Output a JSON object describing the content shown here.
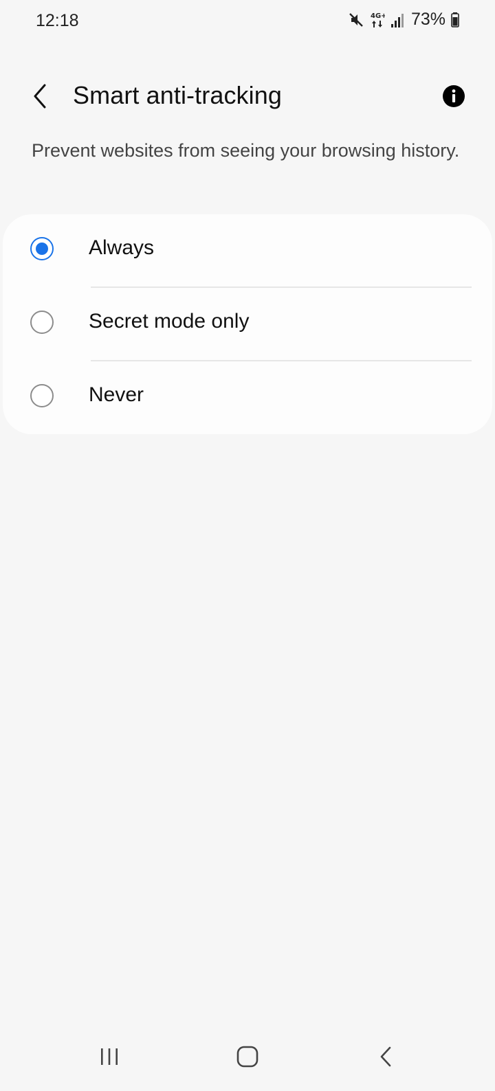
{
  "status_bar": {
    "time": "12:18",
    "battery": "73%",
    "icons": [
      "mute-icon",
      "4g-icon",
      "signal-icon",
      "battery-icon"
    ]
  },
  "header": {
    "title": "Smart anti-tracking",
    "back_icon": "chevron-left-icon",
    "info_icon": "info-icon"
  },
  "description": "Prevent websites from seeing your browsing history.",
  "options": [
    {
      "label": "Always",
      "selected": true
    },
    {
      "label": "Secret mode only",
      "selected": false
    },
    {
      "label": "Never",
      "selected": false
    }
  ],
  "nav_bar": {
    "icons": [
      "recent-apps-icon",
      "home-icon",
      "back-icon"
    ]
  },
  "colors": {
    "accent": "#1a73e8",
    "background": "#f6f6f6",
    "card": "#fdfdfd"
  }
}
